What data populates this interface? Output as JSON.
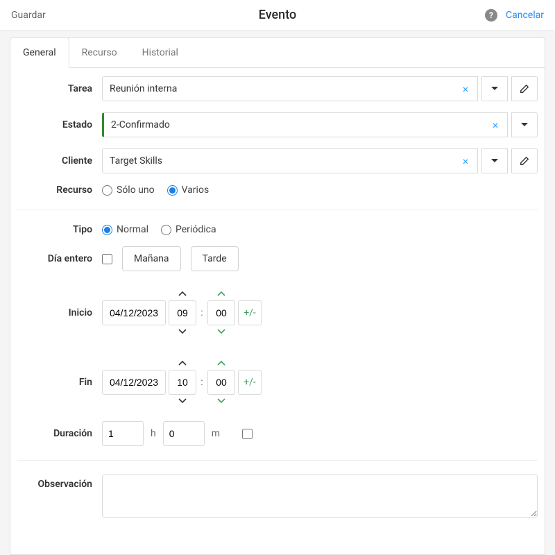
{
  "header": {
    "save": "Guardar",
    "title": "Evento",
    "cancel": "Cancelar"
  },
  "tabs": {
    "general": "General",
    "recurso": "Recurso",
    "historial": "Historial"
  },
  "labels": {
    "tarea": "Tarea",
    "estado": "Estado",
    "cliente": "Cliente",
    "recurso": "Recurso",
    "tipo": "Tipo",
    "dia_entero": "Día entero",
    "inicio": "Inicio",
    "fin": "Fin",
    "duracion": "Duración",
    "observacion": "Observación"
  },
  "fields": {
    "tarea": "Reunión interna",
    "estado": "2-Confirmado",
    "cliente": "Target Skills",
    "recurso_options": {
      "solo": "Sólo uno",
      "varios": "Varios"
    },
    "tipo_options": {
      "normal": "Normal",
      "periodica": "Periódica"
    },
    "day_btns": {
      "manana": "Mañana",
      "tarde": "Tarde"
    },
    "inicio_date": "04/12/2023",
    "inicio_hour": "09",
    "inicio_min": "00",
    "fin_date": "04/12/2023",
    "fin_hour": "10",
    "fin_min": "00",
    "pm_label": "+/-",
    "dur_h": "1",
    "dur_m": "0",
    "h_unit": "h",
    "m_unit": "m",
    "observacion": ""
  },
  "icons": {
    "clear": "×"
  }
}
